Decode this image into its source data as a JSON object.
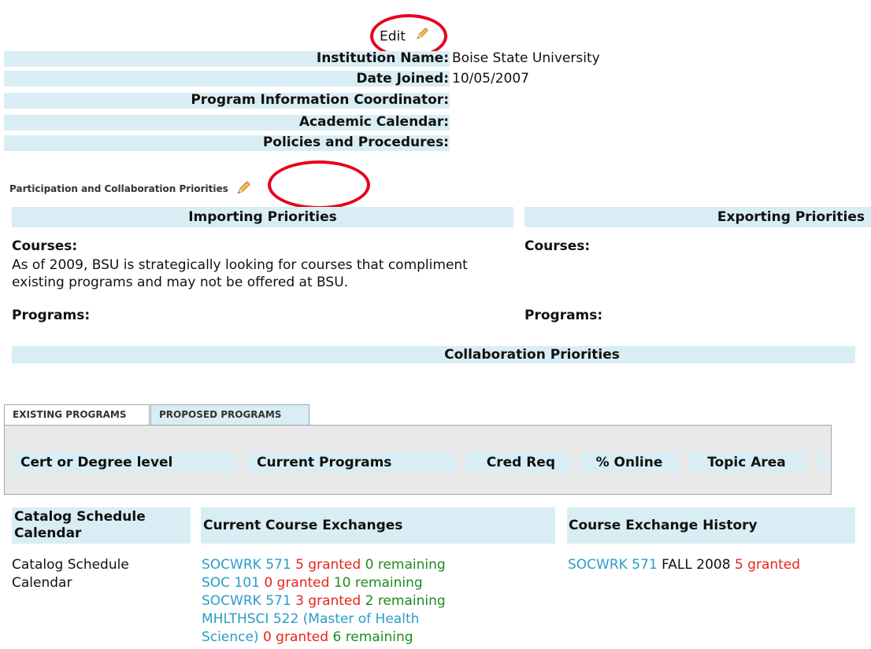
{
  "edit": {
    "label": "Edit"
  },
  "institution": {
    "fields": [
      {
        "label": "Institution Name:",
        "value": "Boise State University"
      },
      {
        "label": "Date Joined:",
        "value": "10/05/2007"
      },
      {
        "label": "Program Information Coordinator:",
        "value": ""
      },
      {
        "label": "Academic Calendar:",
        "value": ""
      },
      {
        "label": "Policies and Procedures:",
        "value": ""
      }
    ]
  },
  "participation": {
    "title": "Participation and Collaboration Priorities",
    "importing_header": "Importing Priorities",
    "exporting_header": "Exporting Priorities",
    "courses_label": "Courses:",
    "importing_courses_text_line1": "As of 2009, BSU is strategically looking for courses that compliment",
    "importing_courses_text_line2": "existing programs and may not be offered at BSU.",
    "programs_label": "Programs:",
    "collaboration_header": "Collaboration Priorities"
  },
  "tabs": [
    {
      "label": "EXISTING PROGRAMS",
      "active": true
    },
    {
      "label": "PROPOSED PROGRAMS",
      "active": false
    }
  ],
  "programs_table": {
    "columns": [
      "Cert or Degree level",
      "Current Programs",
      "Cred Req",
      "% Online",
      "Topic Area"
    ]
  },
  "catalog": {
    "header": "Catalog Schedule Calendar",
    "header_line1": "Catalog Schedule",
    "header_line2": "Calendar",
    "value_line1": "Catalog Schedule",
    "value_line2": "Calendar"
  },
  "current_exchanges": {
    "header": "Current Course Exchanges",
    "items": [
      {
        "course": "SOCWRK 571",
        "granted": "5 granted",
        "remaining": "0 remaining"
      },
      {
        "course": "SOC 101",
        "granted": "0 granted",
        "remaining": "10 remaining"
      },
      {
        "course": "SOCWRK 571",
        "granted": "3 granted",
        "remaining": "2 remaining"
      },
      {
        "course_line1": "MHLTHSCI 522 (Master of Health",
        "course_line2": "Science)",
        "granted": "0 granted",
        "remaining": "6 remaining"
      }
    ]
  },
  "exchange_history": {
    "header": "Course Exchange History",
    "items": [
      {
        "course": "SOCWRK 571",
        "term": "FALL 2008",
        "granted": "5 granted"
      }
    ]
  },
  "colors": {
    "band": "#d8eef4",
    "link": "#2b9bc9",
    "granted": "#e8231c",
    "remaining": "#1f8a1f",
    "annotation": "#e8001a"
  },
  "icons": [
    "pencil-icon",
    "pencil-icon"
  ]
}
